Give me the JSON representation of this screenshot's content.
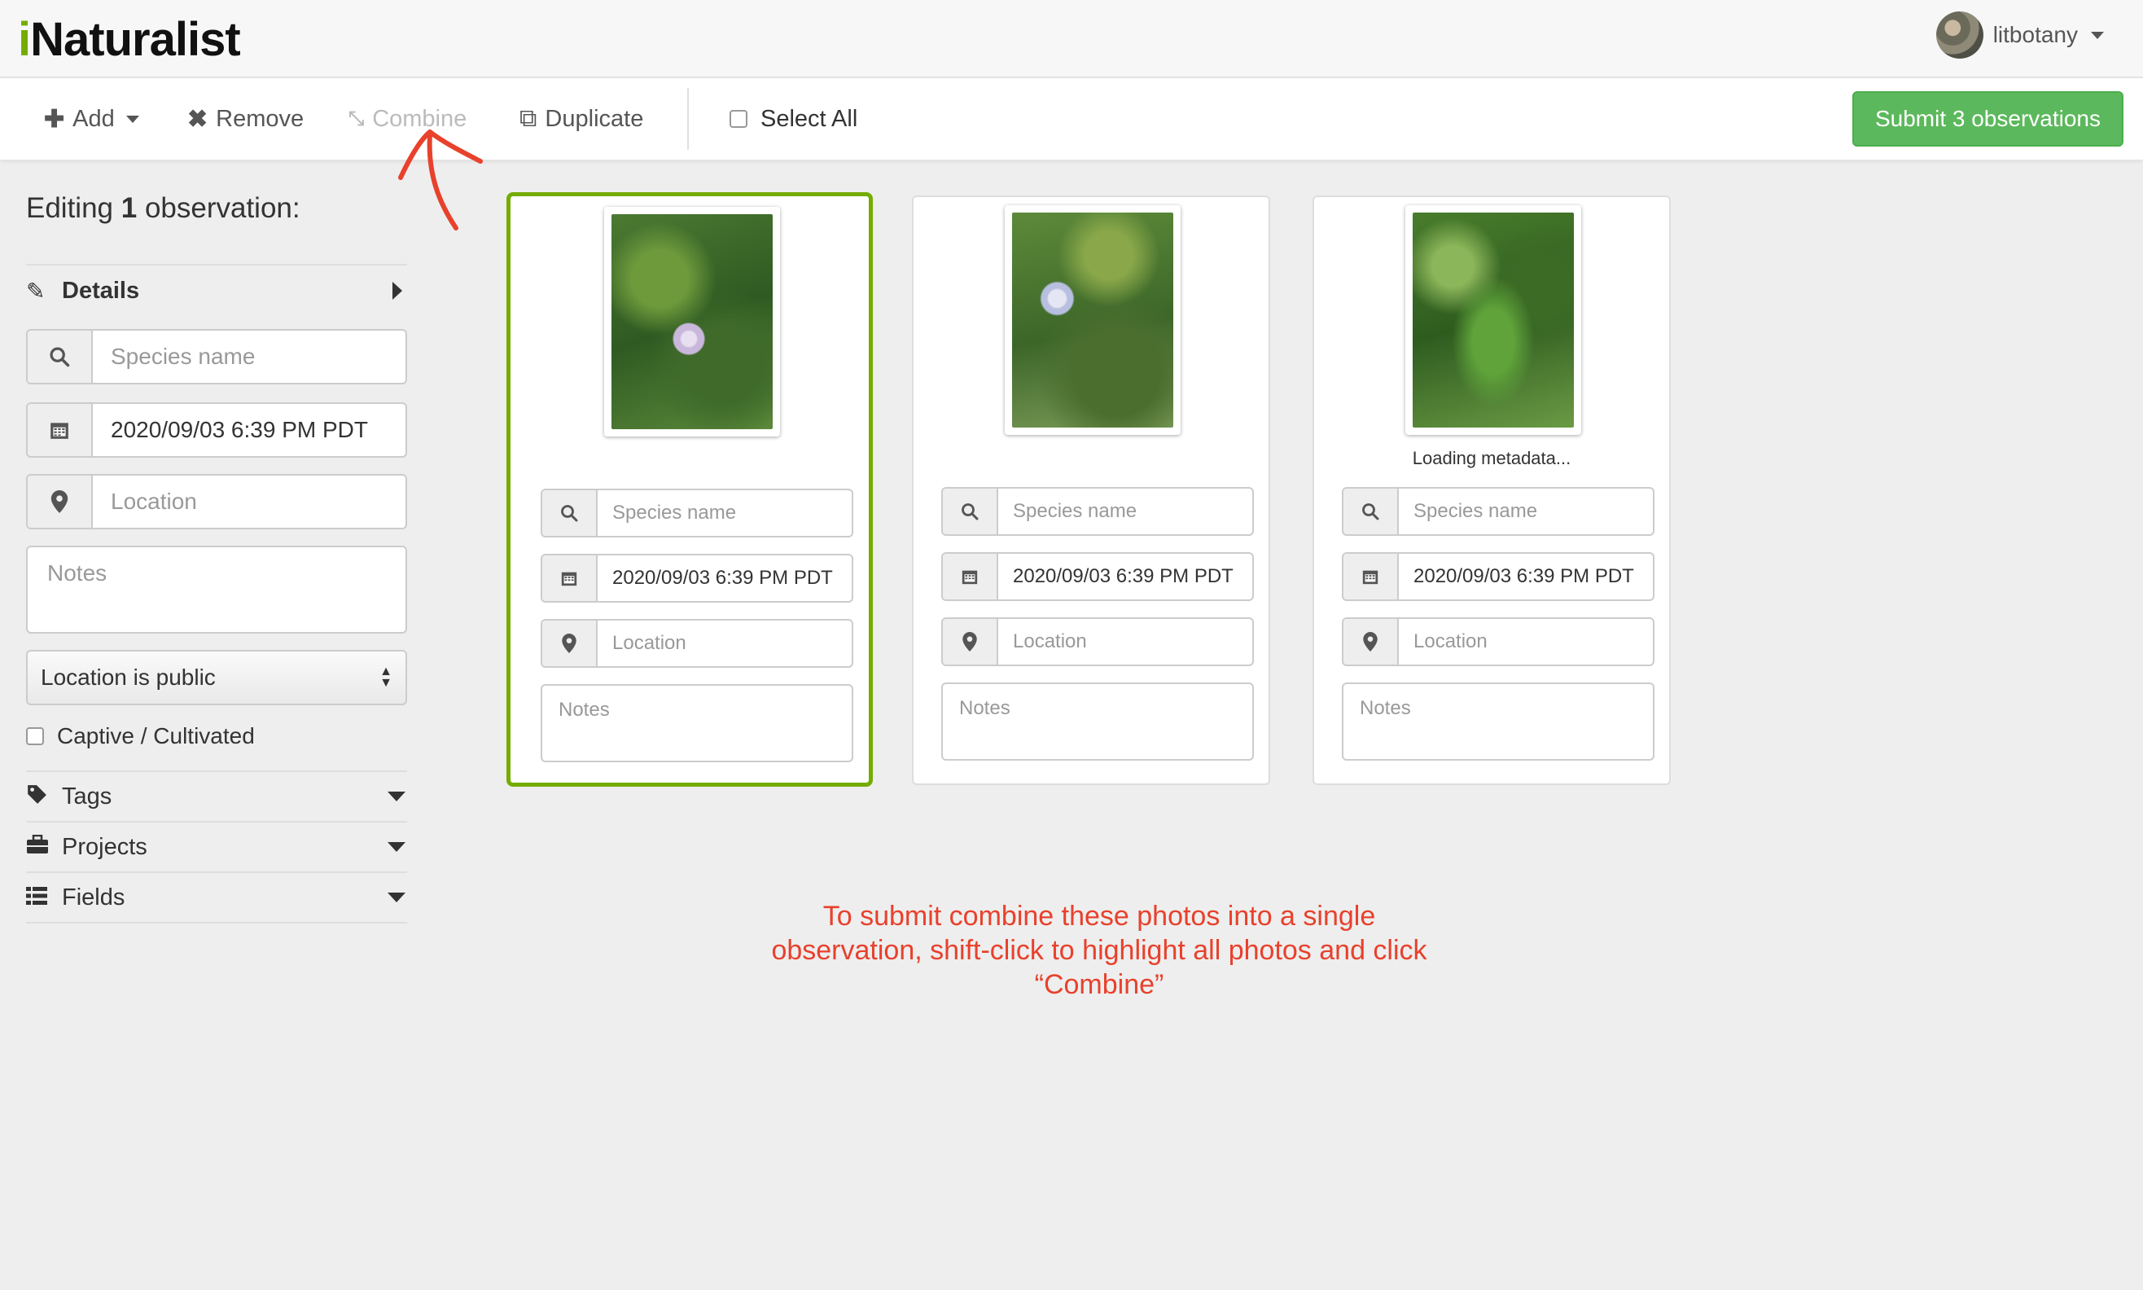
{
  "header": {
    "logo_prefix": "i",
    "logo_rest": "Naturalist",
    "username": "litbotany"
  },
  "toolbar": {
    "add_label": "Add",
    "remove_label": "Remove",
    "combine_label": "Combine",
    "duplicate_label": "Duplicate",
    "select_all_label": "Select All",
    "submit_label": "Submit 3 observations"
  },
  "left_panel": {
    "editing_prefix": "Editing ",
    "editing_count": "1",
    "editing_suffix": " observation:",
    "details_label": "Details",
    "species_placeholder": "Species name",
    "date_value": "2020/09/03 6:39 PM PDT",
    "location_placeholder": "Location",
    "notes_placeholder": "Notes",
    "privacy_value": "Location is public",
    "captive_label": "Captive / Cultivated",
    "tags_label": "Tags",
    "projects_label": "Projects",
    "fields_label": "Fields"
  },
  "cards": [
    {
      "species_placeholder": "Species name",
      "date_value": "2020/09/03 6:39 PM PDT",
      "location_placeholder": "Location",
      "notes_placeholder": "Notes",
      "status": ""
    },
    {
      "species_placeholder": "Species name",
      "date_value": "2020/09/03 6:39 PM PDT",
      "location_placeholder": "Location",
      "notes_placeholder": "Notes",
      "status": ""
    },
    {
      "species_placeholder": "Species name",
      "date_value": "2020/09/03 6:39 PM PDT",
      "location_placeholder": "Location",
      "notes_placeholder": "Notes",
      "status": "Loading metadata..."
    }
  ],
  "annotation": {
    "line1": "To submit combine these photos into a single",
    "line2": "observation, shift-click to highlight all photos and click",
    "line3": "“Combine”"
  },
  "colors": {
    "brand_green": "#74ac00",
    "submit_green": "#5cb85c",
    "annotation_red": "#e8412c"
  },
  "icons": [
    "plus-icon",
    "x-icon",
    "combine-icon",
    "duplicate-icon",
    "pencil-icon",
    "search-icon",
    "calendar-icon",
    "map-marker-icon",
    "tag-icon",
    "briefcase-icon",
    "list-icon"
  ]
}
